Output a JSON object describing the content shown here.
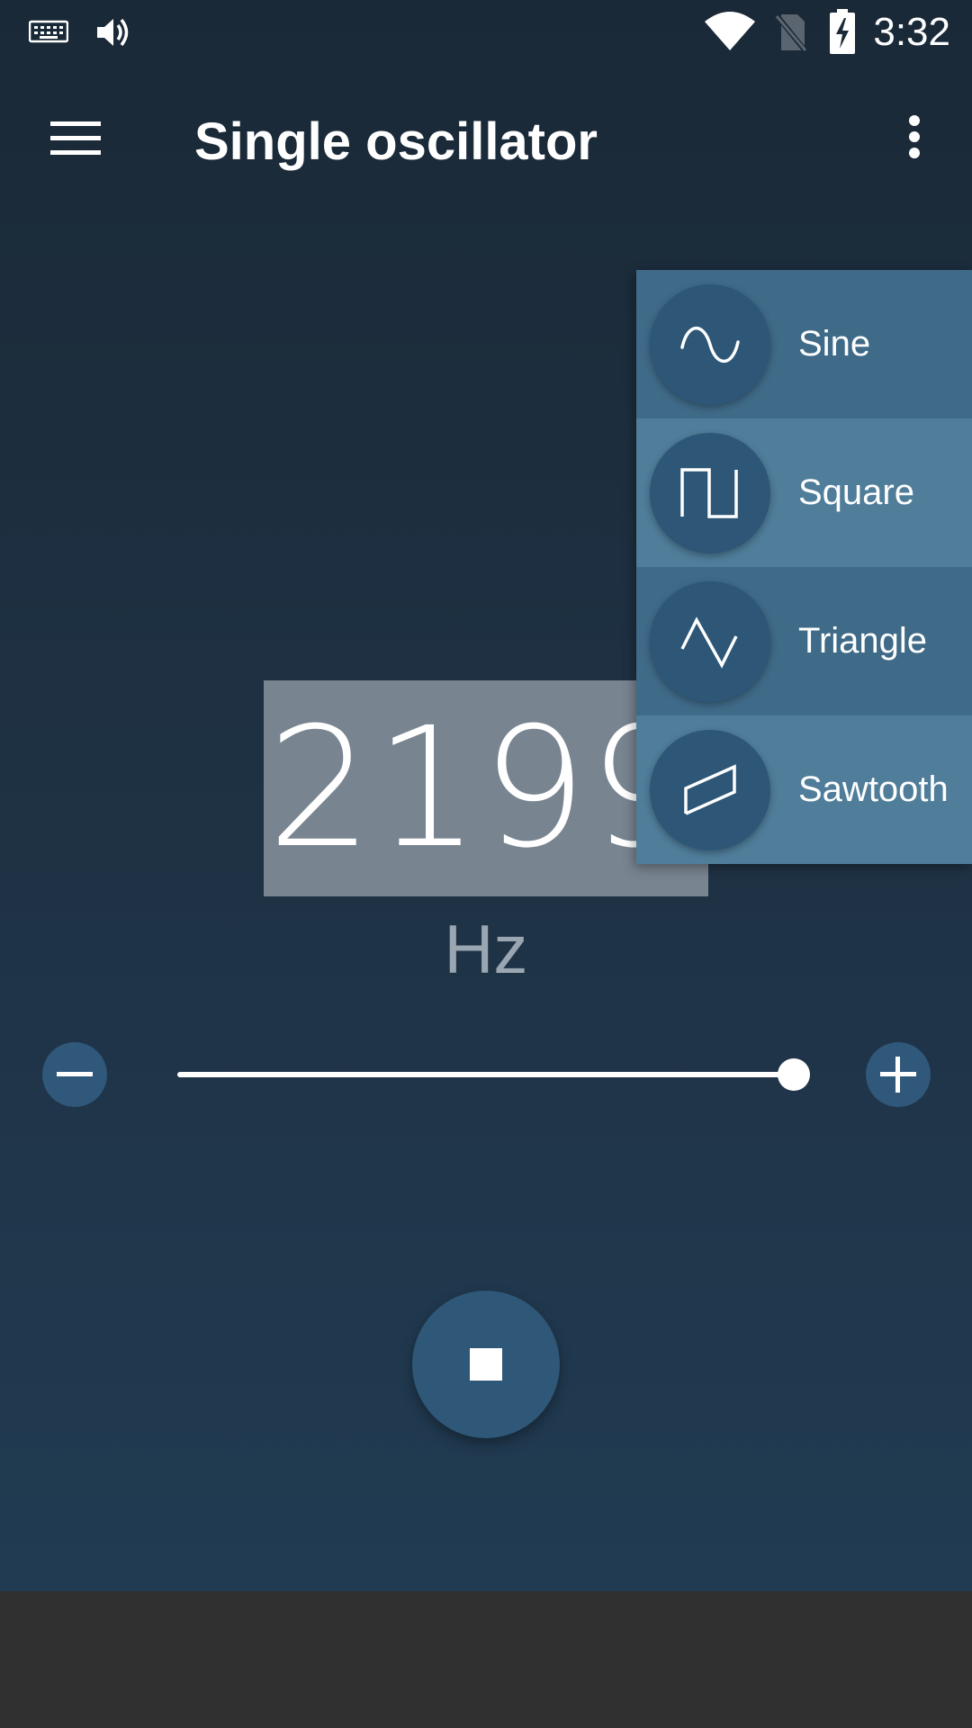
{
  "status_bar": {
    "time": "3:32",
    "icons": [
      "keyboard-icon",
      "volume-icon",
      "wifi-icon",
      "no-sim-icon",
      "battery-charging-icon"
    ]
  },
  "app_bar": {
    "title": "Single oscillator",
    "menu_icon": "menu-icon",
    "overflow_icon": "more-vert-icon"
  },
  "frequency": {
    "value": "21999",
    "unit": "Hz"
  },
  "slider": {
    "value_fraction": 1.0,
    "minus_icon": "minus-icon",
    "plus_icon": "plus-icon"
  },
  "playback": {
    "state": "playing",
    "icon": "stop-icon"
  },
  "waveform_menu": {
    "items": [
      {
        "label": "Sine",
        "icon": "sine-wave-icon"
      },
      {
        "label": "Square",
        "icon": "square-wave-icon"
      },
      {
        "label": "Triangle",
        "icon": "triangle-wave-icon"
      },
      {
        "label": "Sawtooth",
        "icon": "sawtooth-wave-icon"
      }
    ]
  },
  "colors": {
    "background_top": "#1a2937",
    "background_bottom": "#213d55",
    "accent": "#2f587a",
    "menu_item_dark": "#3f6a88",
    "menu_item_light": "#4f7d9a",
    "selection_highlight": "#788490",
    "nav_bar": "#303030"
  }
}
